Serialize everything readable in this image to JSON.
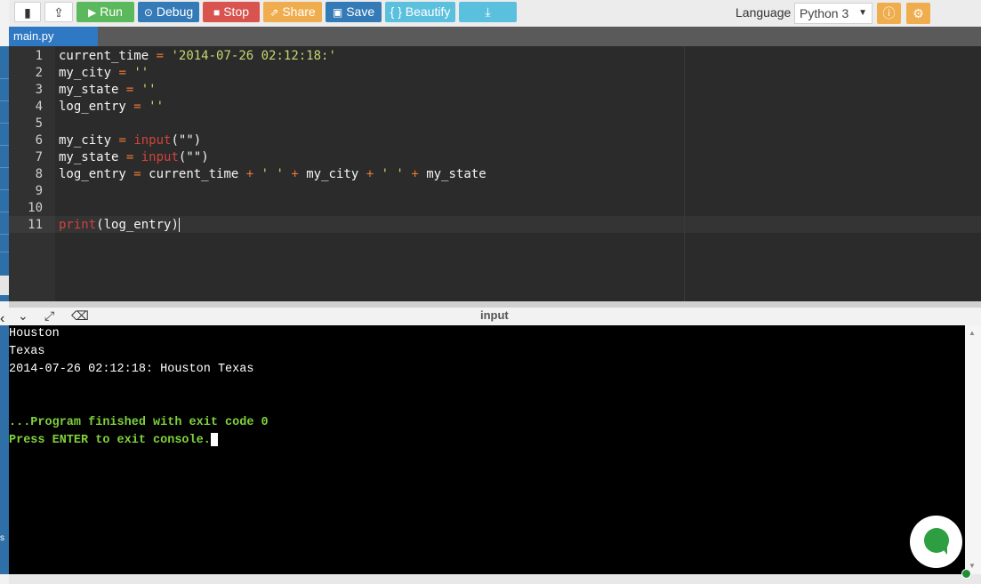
{
  "toolbar": {
    "run_label": "Run",
    "debug_label": "Debug",
    "stop_label": "Stop",
    "share_label": "Share",
    "save_label": "Save",
    "beautify_label": "{ } Beautify",
    "language_label": "Language",
    "language_value": "Python 3",
    "icons": [
      "new-file-icon",
      "upload-icon",
      "play-icon",
      "debug-icon",
      "stop-icon",
      "share-icon",
      "save-icon",
      "download-icon",
      "info-icon",
      "gear-icon"
    ],
    "colors": {
      "run": "#5cb85c",
      "debug": "#337ab7",
      "stop": "#d9534f",
      "share": "#f0ad4e",
      "save": "#337ab7",
      "beautify": "#5bc0de",
      "download": "#5bc0de",
      "orange": "#f0ad4e"
    }
  },
  "file_tab": {
    "name": "main.py"
  },
  "editor": {
    "line_numbers": [
      "1",
      "2",
      "3",
      "4",
      "5",
      "6",
      "7",
      "8",
      "9",
      "10",
      "11"
    ],
    "lines": [
      "current_time = '2014-07-26 02:12:18:'",
      "my_city = ''",
      "my_state = ''",
      "log_entry = ''",
      "",
      "my_city = input(\"\")",
      "my_state = input(\"\")",
      "log_entry = current_time + ' ' + my_city + ' ' + my_state",
      "",
      "",
      "print(log_entry)"
    ],
    "tokens": {
      "l1_var": "current_time",
      "l1_op": "=",
      "l1_str": "'2014-07-26 02:12:18:'",
      "l2_var": "my_city",
      "l2_op": "=",
      "l2_str": "''",
      "l3_var": "my_state",
      "l3_op": "=",
      "l3_str": "''",
      "l4_var": "log_entry",
      "l4_op": "=",
      "l4_str": "''",
      "l6_var": "my_city",
      "l6_op": "=",
      "l6_fn": "input",
      "l6_args": "(\"\")",
      "l7_var": "my_state",
      "l7_op": "=",
      "l7_fn": "input",
      "l7_args": "(\"\")",
      "l8_var": "log_entry",
      "l8_op": "=",
      "l8_a": "current_time",
      "l8_plus": "+",
      "l8_sp": "' '",
      "l8_b": "my_city",
      "l8_c": "my_state",
      "l11_fn": "print",
      "l11_args": "(log_entry)"
    }
  },
  "console": {
    "title": "input",
    "output": [
      "Houston",
      "Texas",
      "2014-07-26 02:12:18: Houston Texas",
      "",
      "",
      "...Program finished with exit code 0",
      "Press ENTER to exit console."
    ]
  }
}
